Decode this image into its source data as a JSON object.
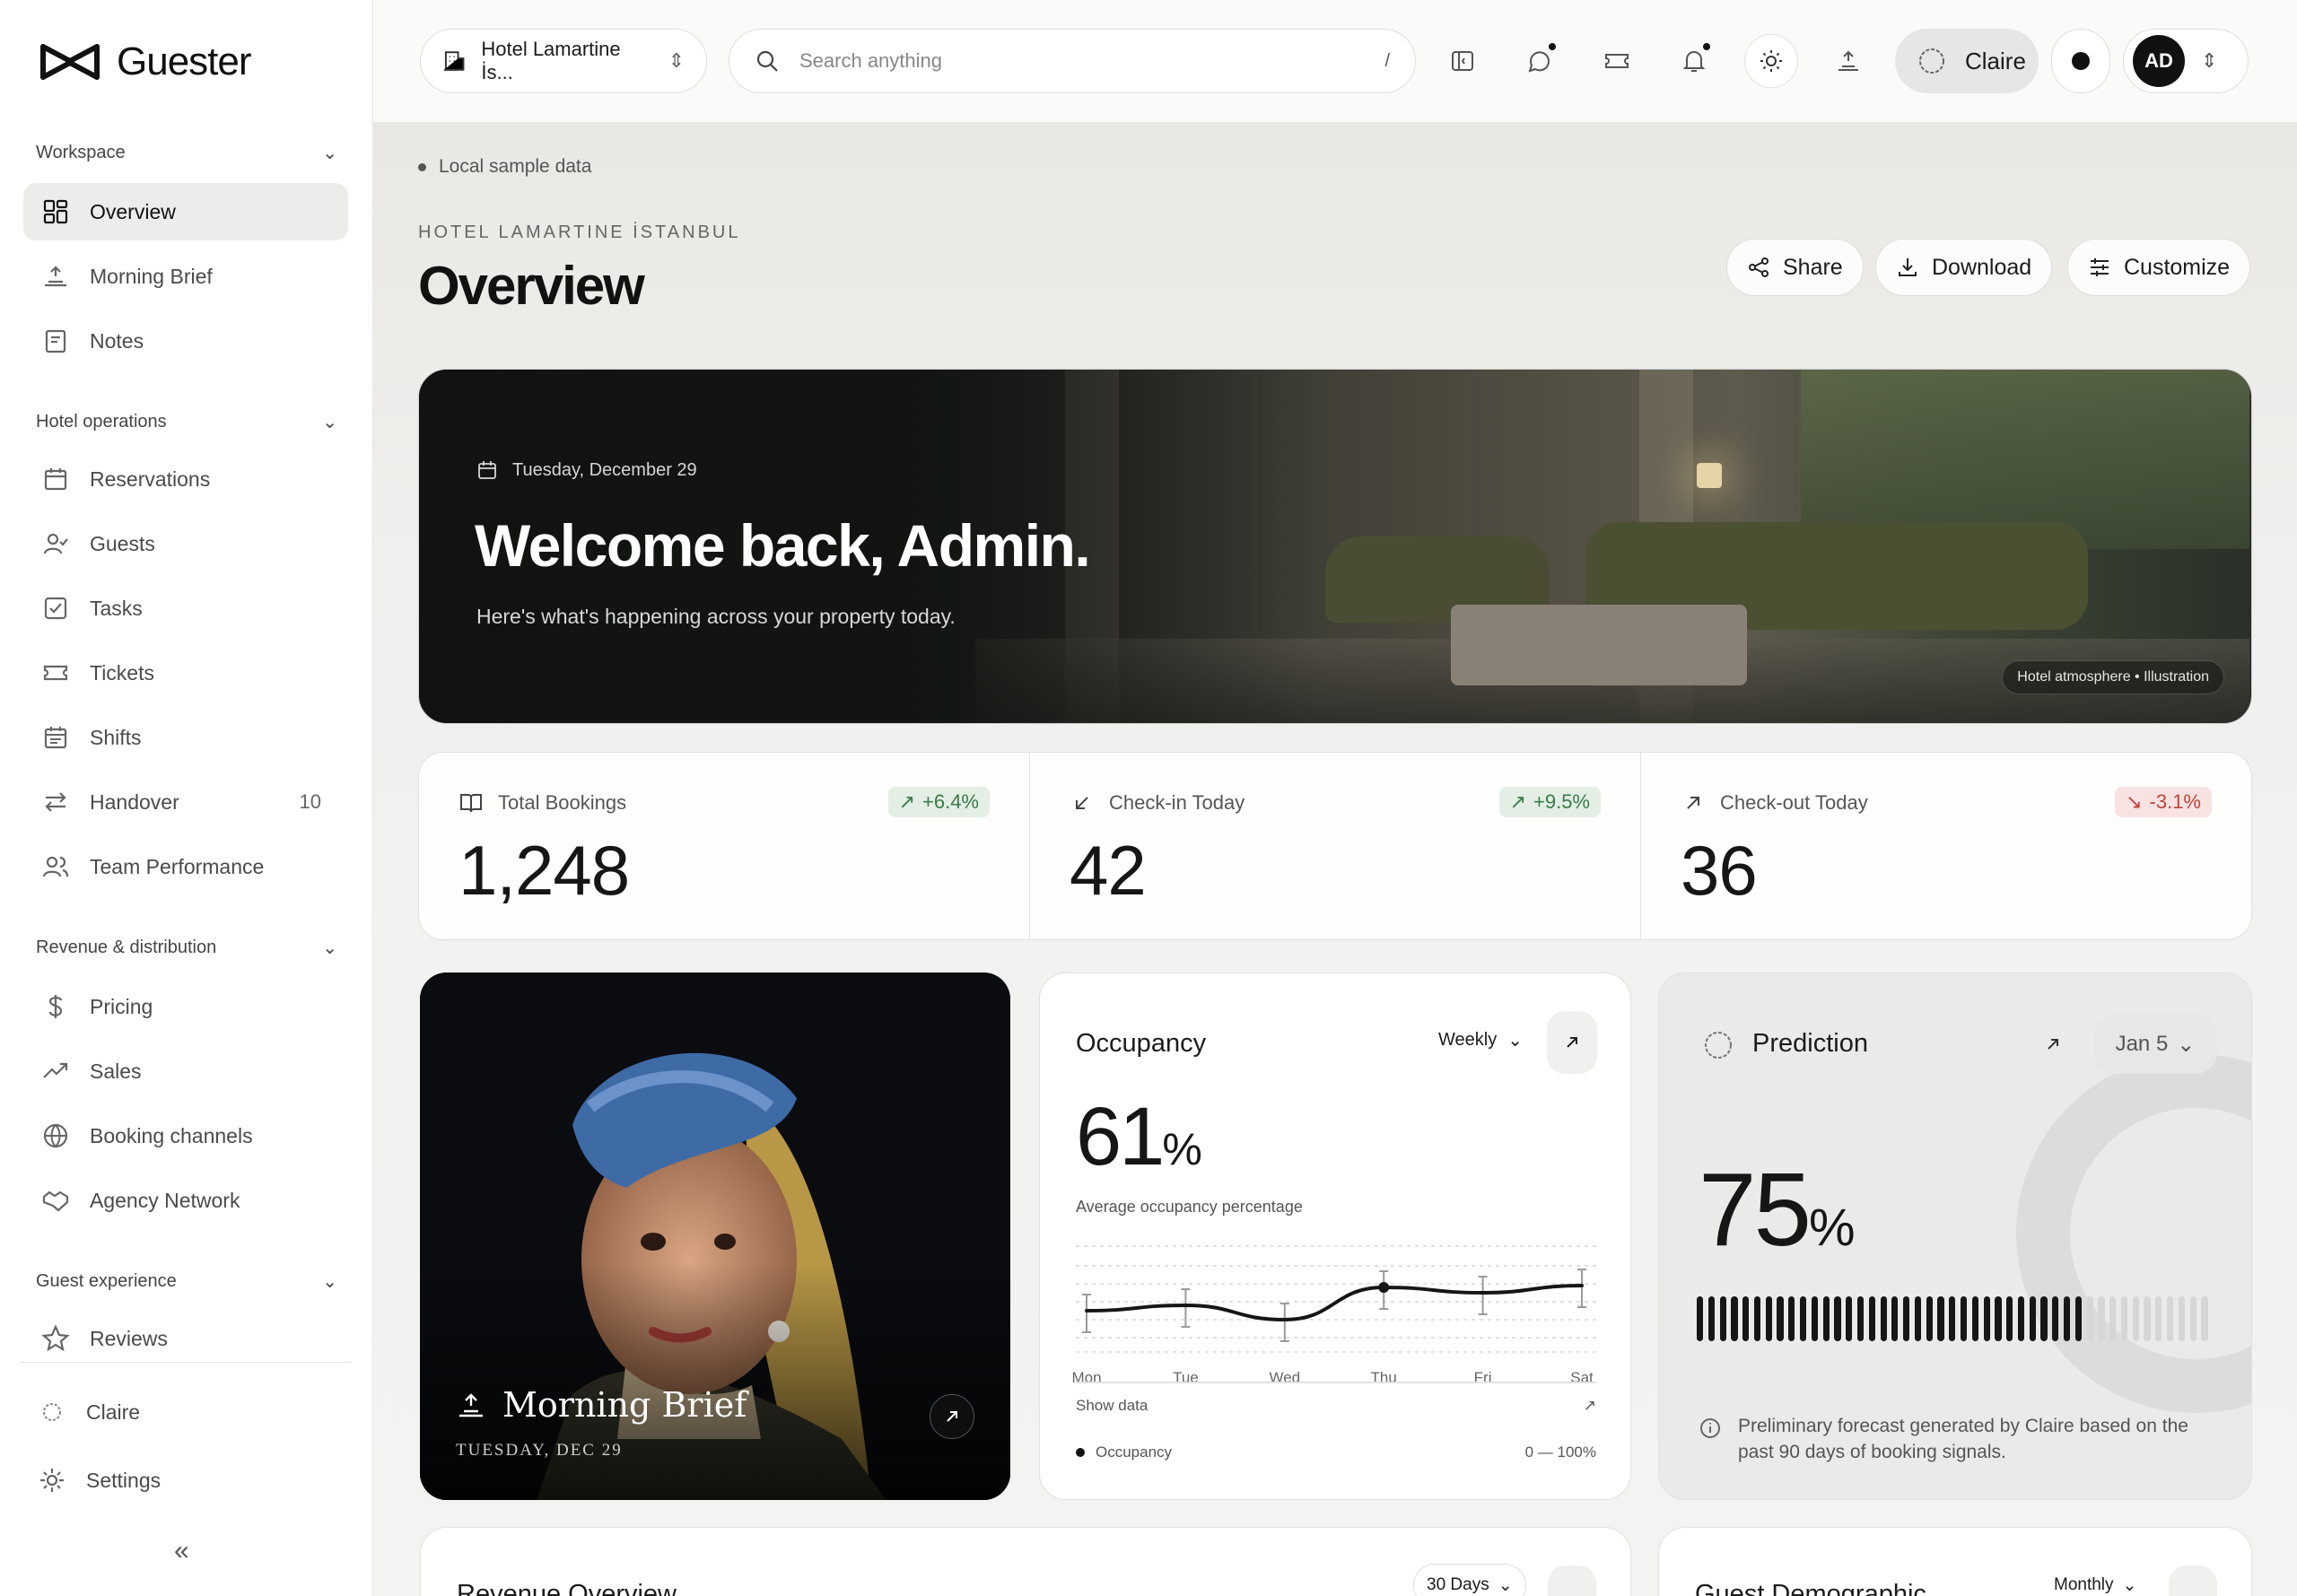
{
  "brand": {
    "name": "Guester"
  },
  "sidebar": {
    "sections": [
      {
        "title": "Workspace"
      },
      {
        "title": "Hotel operations"
      },
      {
        "title": "Revenue & distribution"
      },
      {
        "title": "Guest experience"
      }
    ],
    "items": [
      {
        "label": "Overview"
      },
      {
        "label": "Morning Brief"
      },
      {
        "label": "Notes"
      },
      {
        "label": "Reservations"
      },
      {
        "label": "Guests"
      },
      {
        "label": "Tasks"
      },
      {
        "label": "Tickets"
      },
      {
        "label": "Shifts"
      },
      {
        "label": "Handover",
        "count": "10"
      },
      {
        "label": "Team Performance"
      },
      {
        "label": "Pricing"
      },
      {
        "label": "Sales"
      },
      {
        "label": "Booking channels"
      },
      {
        "label": "Agency Network"
      },
      {
        "label": "Reviews"
      }
    ],
    "footer": {
      "claire": "Claire",
      "settings": "Settings",
      "collapse": "«"
    }
  },
  "topbar": {
    "hotel": "Hotel Lamartine İs...",
    "search_placeholder": "Search anything",
    "search_shortcut": "/",
    "assistant": "Claire",
    "avatar_initials": "AD"
  },
  "page": {
    "notice": "Local sample data",
    "hotel_label": "HOTEL LAMARTINE İSTANBUL",
    "title": "Overview",
    "actions": {
      "share": "Share",
      "download": "Download",
      "customize": "Customize"
    }
  },
  "hero": {
    "date": "Tuesday, December 29",
    "title": "Welcome back, Admin.",
    "subtitle": "Here's what's happening across your property today.",
    "tag": "Hotel atmosphere • Illustration"
  },
  "stats": [
    {
      "label": "Total Bookings",
      "value": "1,248",
      "change": "+6.4%",
      "trend": "up"
    },
    {
      "label": "Check-in Today",
      "value": "42",
      "change": "+9.5%",
      "trend": "up"
    },
    {
      "label": "Check-out Today",
      "value": "36",
      "change": "-3.1%",
      "trend": "down"
    }
  ],
  "brief": {
    "title": "Morning Brief",
    "date": "TUESDAY, DEC 29"
  },
  "occupancy": {
    "title": "Occupancy",
    "period": "Weekly",
    "value": "61",
    "unit": "%",
    "subtitle": "Average occupancy percentage",
    "show_data": "Show data",
    "legend": "Occupancy",
    "range": "0 — 100%"
  },
  "chart_data": {
    "type": "line",
    "categories": [
      "Mon",
      "Tue",
      "Wed",
      "Thu",
      "Fri",
      "Sat"
    ],
    "series": [
      {
        "name": "Occupancy",
        "values": [
          55,
          58,
          50,
          68,
          65,
          69
        ]
      }
    ],
    "ylim": [
      0,
      100
    ],
    "highlight_index": 3
  },
  "prediction": {
    "title": "Prediction",
    "date": "Jan 5",
    "value": "75",
    "unit": "%",
    "level": 0.75,
    "note": "Preliminary forecast generated by Claire based on the past 90 days of booking signals."
  },
  "bottom": {
    "revenue": {
      "title": "Revenue Overview",
      "period": "30 Days"
    },
    "demographic": {
      "title": "Guest Demographic",
      "period": "Monthly"
    }
  },
  "colors": {
    "positive": "#3a7a48",
    "negative": "#c0413a",
    "dark": "#111111"
  }
}
